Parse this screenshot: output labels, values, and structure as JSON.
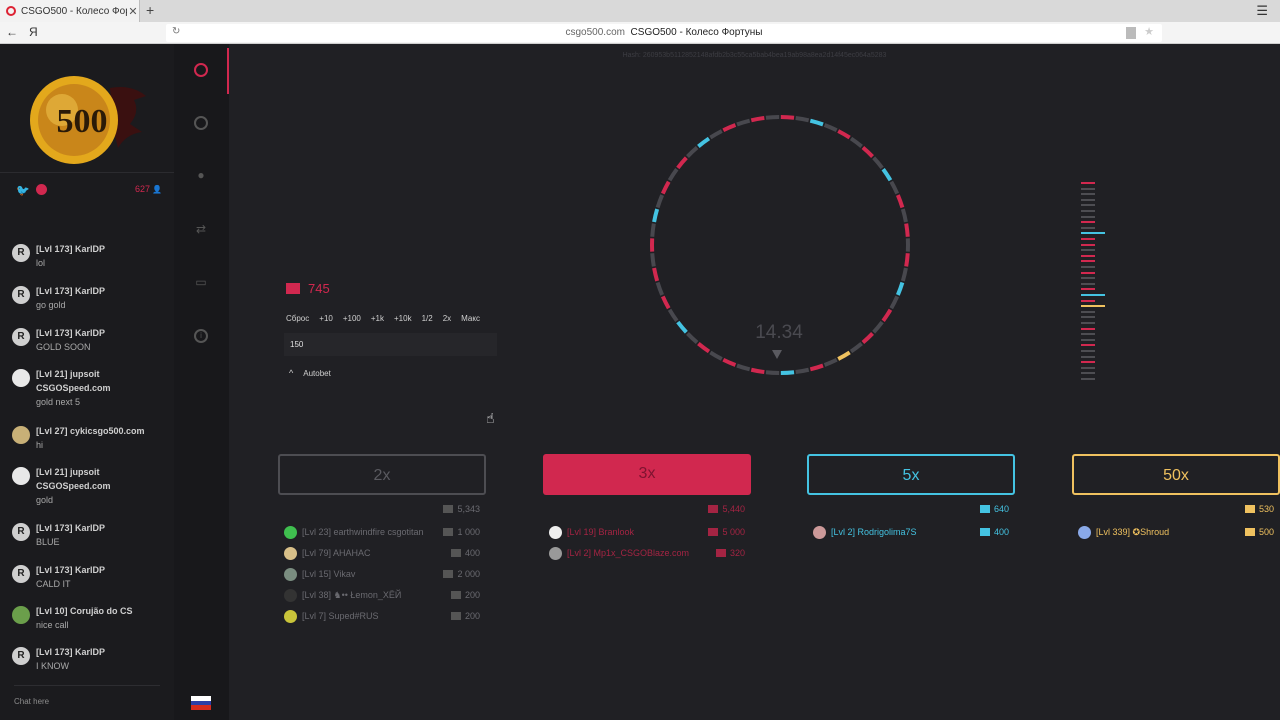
{
  "browser": {
    "tab_title": "CSGO500 - Колесо Фортуны",
    "tab_close": "✕",
    "new_tab": "+",
    "menu": "☰",
    "back": "←",
    "ya": "Я",
    "url_domain": "csgo500.com",
    "url_title": "CSGO500 - Колесо Фортуны"
  },
  "chat": {
    "online_count": "627",
    "input_placeholder": "Chat here",
    "messages": [
      {
        "name": "[Lvl 173] KarlDP",
        "text": "lol",
        "avatar": "R"
      },
      {
        "name": "[Lvl 173] KarlDP",
        "text": "go gold",
        "avatar": "R"
      },
      {
        "name": "[Lvl 173] KarlDP",
        "text": "GOLD SOON",
        "avatar": "R"
      },
      {
        "name": "[Lvl 21] jupsoit CSGOSpeed.com",
        "text": "gold next 5",
        "avatar": ""
      },
      {
        "name": "[Lvl 27] cykicsgo500.com",
        "text": "hi",
        "avatar": ""
      },
      {
        "name": "[Lvl 21] jupsoit CSGOSpeed.com",
        "text": "gold",
        "avatar": ""
      },
      {
        "name": "[Lvl 173] KarlDP",
        "text": "BLUE",
        "avatar": "R"
      },
      {
        "name": "[Lvl 173] KarlDP",
        "text": "CALD IT",
        "avatar": "R"
      },
      {
        "name": "[Lvl 10] Corujão do CS",
        "text": "nice call",
        "avatar": ""
      },
      {
        "name": "[Lvl 173] KarlDP",
        "text": "I KNOW",
        "avatar": "R"
      }
    ]
  },
  "game": {
    "hash": "Hash: 260953b5112852148afdb2b3c55ca5bab4bea19ab98a8ea2d14f45ec064a5283",
    "balance": "745",
    "quick_buttons": [
      "Сброс",
      "+10",
      "+100",
      "+1k",
      "+10k",
      "1/2",
      "2x",
      "Макс"
    ],
    "bet_value": "150",
    "autobet_label": "Autobet",
    "timer": "14.34"
  },
  "colors": {
    "grey": "#4d4d52",
    "red": "#d1284f",
    "blue": "#44c3e2",
    "gold": "#efc15f"
  },
  "columns": [
    {
      "label": "2x",
      "total": "5,343",
      "bets": [
        {
          "name": "[Lvl 23] earthwindfire csgotitan",
          "amount": "1 000"
        },
        {
          "name": "[Lvl 79] AHAHAC",
          "amount": "400"
        },
        {
          "name": "[Lvl 15] Vikav",
          "amount": "2 000"
        },
        {
          "name": "[Lvl 38] ♞•• Łemon_ХЁЙ",
          "amount": "200"
        },
        {
          "name": "[Lvl 7] Suped#RUS",
          "amount": "200"
        }
      ]
    },
    {
      "label": "3x",
      "total": "5,440",
      "bets": [
        {
          "name": "[Lvl 19] Branlook",
          "amount": "5 000"
        },
        {
          "name": "[Lvl 2] Mp1x_CSGOBlaze.com",
          "amount": "320"
        }
      ]
    },
    {
      "label": "5x",
      "total": "640",
      "bets": [
        {
          "name": "[Lvl 2] Rodrigolima7S",
          "amount": "400"
        }
      ]
    },
    {
      "label": "50x",
      "total": "530",
      "bets": [
        {
          "name": "[Lvl 339] ✪Shroud",
          "amount": "500"
        }
      ]
    }
  ]
}
